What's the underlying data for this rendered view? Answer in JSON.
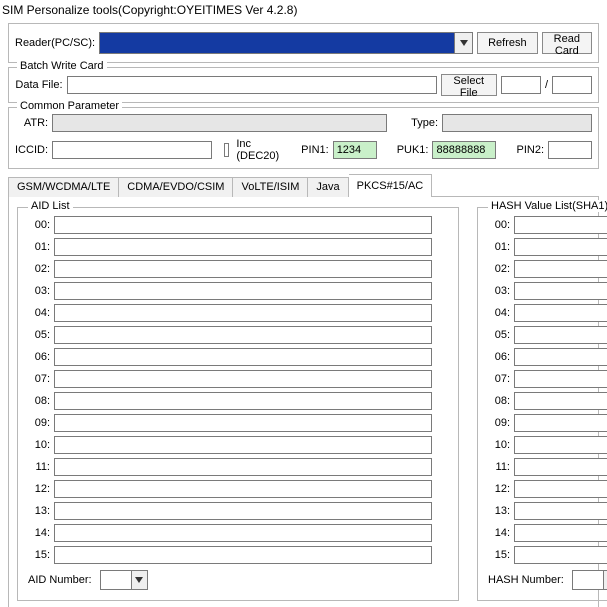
{
  "title": "SIM Personalize tools(Copyright:OYEITIMES Ver 4.2.8)",
  "reader": {
    "label": "Reader(PC/SC):",
    "refresh": "Refresh",
    "readcard": "Read Card"
  },
  "batch": {
    "legend": "Batch Write Card",
    "datafile_label": "Data File:",
    "datafile_value": "",
    "select": "Select File",
    "path_sep": "/"
  },
  "common": {
    "legend": "Common Parameter",
    "atr_label": "ATR:",
    "atr_value": "",
    "type_label": "Type:",
    "type_value": "",
    "iccid_label": "ICCID:",
    "iccid_value": "",
    "inc_label": "Inc  (DEC20)",
    "pin1_label": "PIN1:",
    "pin1_value": "1234",
    "puk1_label": "PUK1:",
    "puk1_value": "88888888",
    "pin2_label": "PIN2:",
    "pin2_value": ""
  },
  "tabs": [
    "GSM/WCDMA/LTE",
    "CDMA/EVDO/CSIM",
    "VoLTE/ISIM",
    "Java",
    "PKCS#15/AC"
  ],
  "active_tab": 4,
  "aid": {
    "legend": "AID List",
    "numbers": [
      "00:",
      "01:",
      "02:",
      "03:",
      "04:",
      "05:",
      "06:",
      "07:",
      "08:",
      "09:",
      "10:",
      "11:",
      "12:",
      "13:",
      "14:",
      "15:"
    ],
    "footer_label": "AID Number:"
  },
  "hash": {
    "legend": "HASH Value List(SHA1)",
    "numbers": [
      "00:",
      "01:",
      "02:",
      "03:",
      "04:",
      "05:",
      "06:",
      "07:",
      "08:",
      "09:",
      "10:",
      "11:",
      "12:",
      "13:",
      "14:",
      "15:"
    ],
    "footer_label": "HASH Number:"
  }
}
